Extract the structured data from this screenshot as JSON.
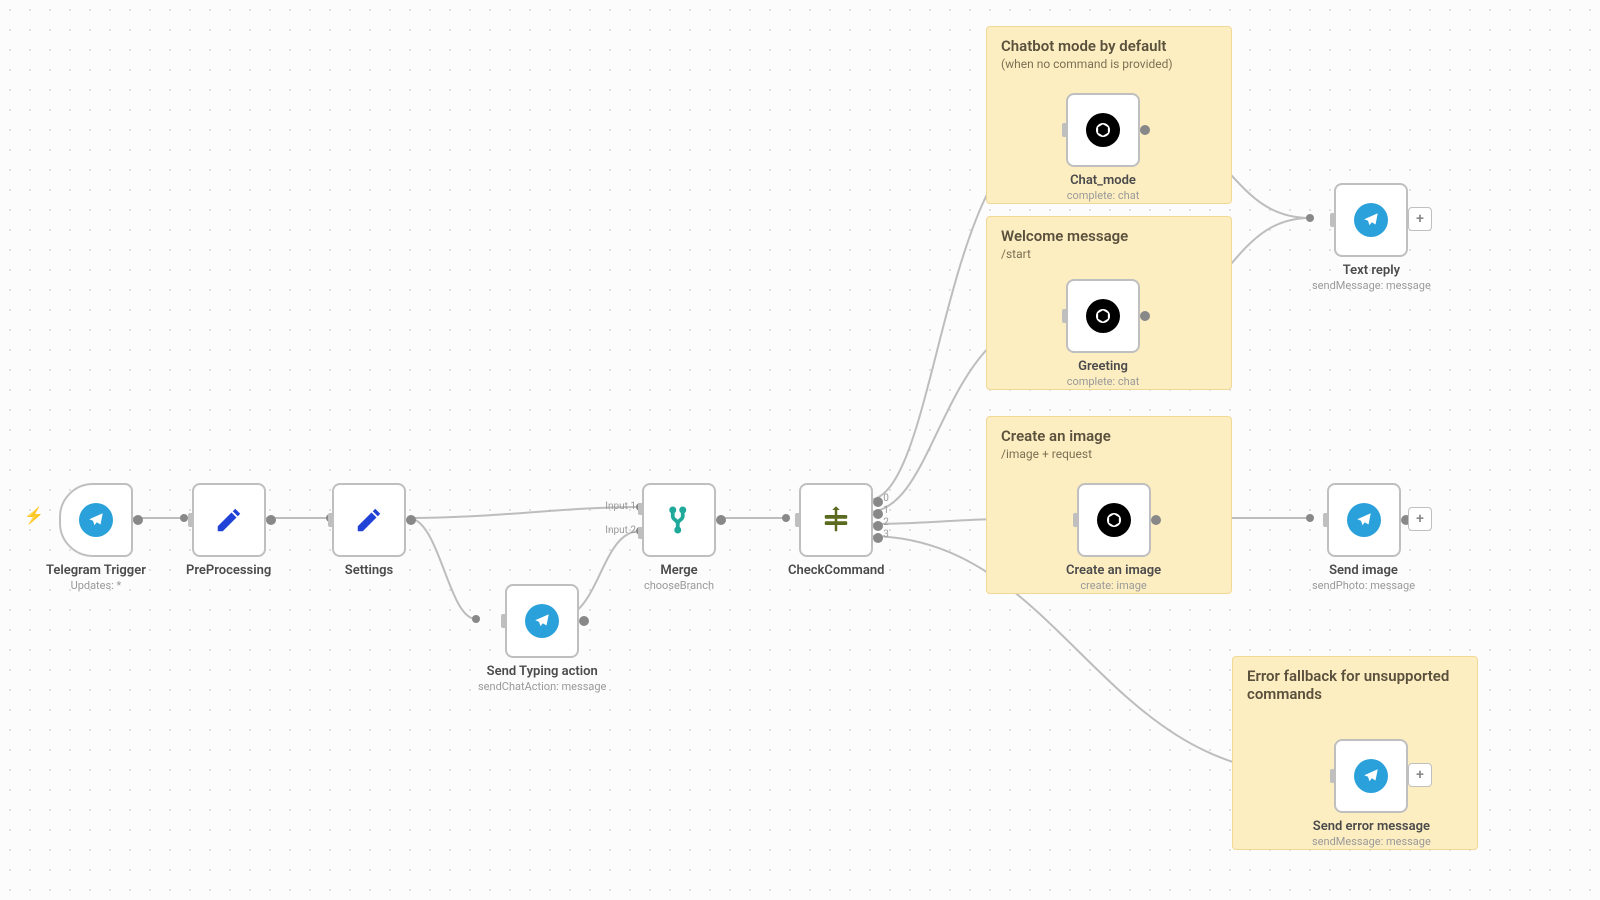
{
  "stickies": {
    "chatmode": {
      "title": "Chatbot mode by default",
      "sub": "(when no command is provided)"
    },
    "welcome": {
      "title": "Welcome message",
      "sub": "/start"
    },
    "createimg": {
      "title": "Create an image",
      "sub": "/image + request"
    },
    "errfallback": {
      "title": "Error fallback for unsupported commands",
      "sub": ""
    }
  },
  "nodes": {
    "trigger": {
      "label": "Telegram Trigger",
      "sub": "Updates: *"
    },
    "preproc": {
      "label": "PreProcessing",
      "sub": ""
    },
    "settings": {
      "label": "Settings",
      "sub": ""
    },
    "typing": {
      "label": "Send Typing action",
      "sub": "sendChatAction: message"
    },
    "merge": {
      "label": "Merge",
      "sub": "chooseBranch",
      "in1": "Input 1",
      "in2": "Input 2"
    },
    "check": {
      "label": "CheckCommand",
      "sub": "",
      "out0": "0",
      "out1": "1",
      "out2": "2",
      "out3": "3"
    },
    "chatmode": {
      "label": "Chat_mode",
      "sub": "complete: chat"
    },
    "greeting": {
      "label": "Greeting",
      "sub": "complete: chat"
    },
    "createimg": {
      "label": "Create an image",
      "sub": "create: image"
    },
    "textreply": {
      "label": "Text reply",
      "sub": "sendMessage: message"
    },
    "sendimg": {
      "label": "Send image",
      "sub": "sendPhoto: message"
    },
    "senderr": {
      "label": "Send error message",
      "sub": "sendMessage: message"
    }
  },
  "addbtn": "+",
  "appearance": {
    "sticky_bg": "#fdeec2",
    "accent": "#2aa1da"
  }
}
